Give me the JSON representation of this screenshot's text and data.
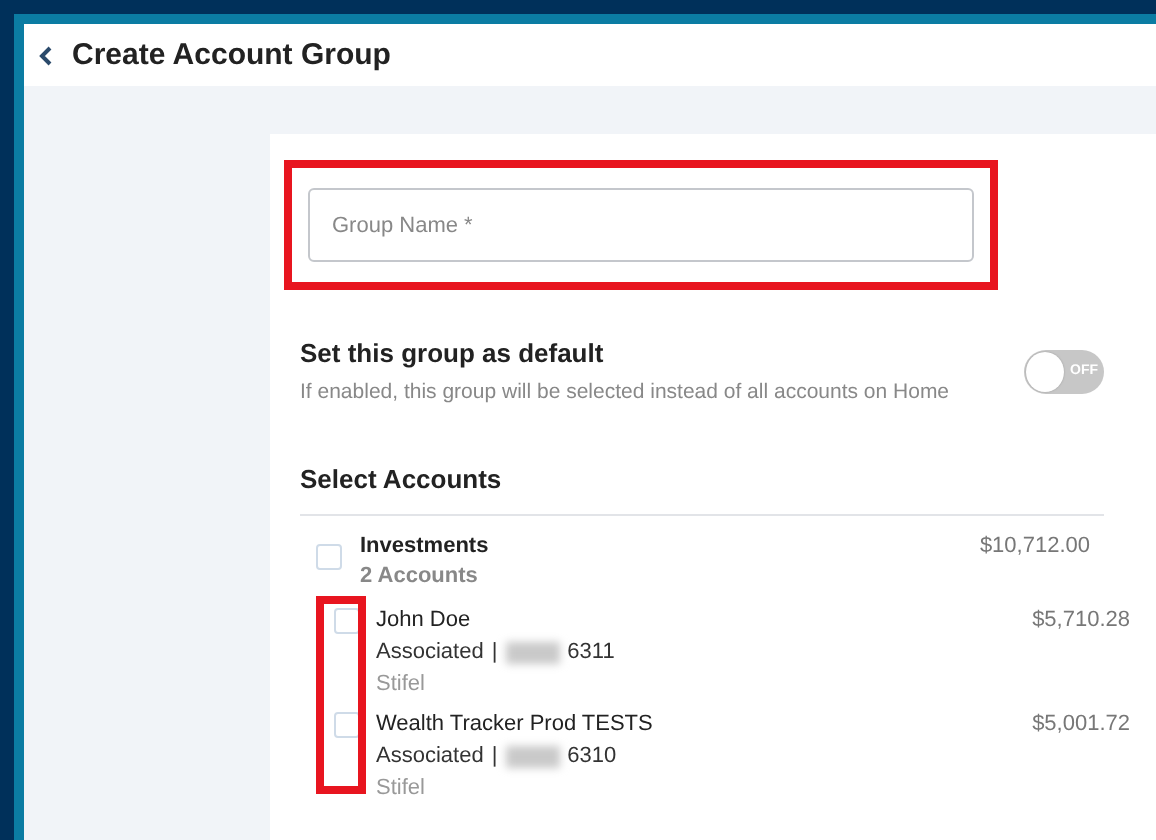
{
  "header": {
    "title": "Create Account Group"
  },
  "group_name": {
    "placeholder": "Group Name *",
    "highlighted": true
  },
  "default_setting": {
    "title": "Set this group as default",
    "description": "If enabled, this group will be selected instead of all accounts on Home",
    "toggle": {
      "on": false,
      "label": "OFF"
    }
  },
  "accounts_section": {
    "title": "Select Accounts",
    "groups": [
      {
        "name": "Investments",
        "count": "2 Accounts",
        "amount": "$10,712.00",
        "checked": false,
        "checkboxes_highlighted": true,
        "accounts": [
          {
            "name": "John Doe",
            "type": "Associated",
            "separator": "|",
            "number_suffix": "6311",
            "institution": "Stifel",
            "amount": "$5,710.28",
            "checked": false
          },
          {
            "name": "Wealth Tracker Prod TESTS",
            "type": "Associated",
            "separator": "|",
            "number_suffix": "6310",
            "institution": "Stifel",
            "amount": "$5,001.72",
            "checked": false
          }
        ]
      }
    ]
  }
}
